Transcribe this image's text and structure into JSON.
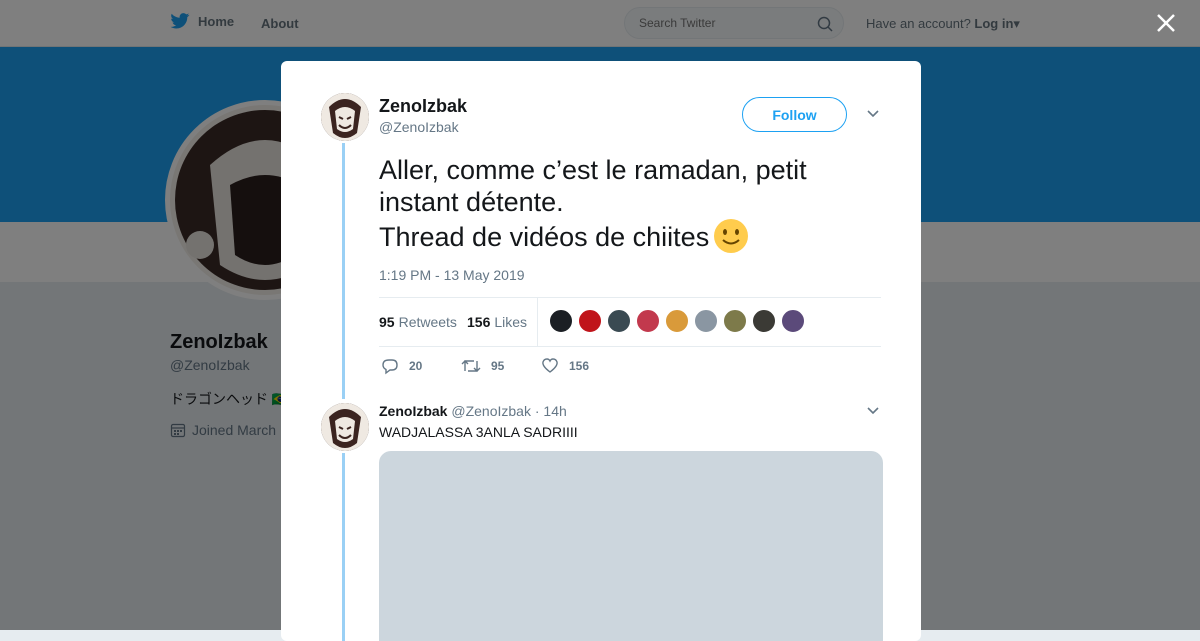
{
  "nav": {
    "home_label": "Home",
    "about_label": "About",
    "search_placeholder": "Search Twitter",
    "account_prompt": "Have an account?",
    "login_label": "Log in"
  },
  "colors": {
    "brand": "#1da1f2",
    "banner": "#1da1f2",
    "thread_line": "#9ad0f5"
  },
  "profile": {
    "name": "ZenoIzbak",
    "handle": "@ZenoIzbak",
    "bio": "ドラゴンヘッド 🇧🇷",
    "joined": "Joined March"
  },
  "tweet": {
    "author_name": "ZenoIzbak",
    "author_handle": "@ZenoIzbak",
    "follow_label": "Follow",
    "text_line1": "Aller, comme c’est le ramadan, petit",
    "text_line2": "instant détente.",
    "text_line3": "Thread de vidéos de chiites",
    "emoji": "slightly-smiling-face-emoji",
    "timestamp": "1:19 PM - 13 May 2019",
    "retweets_count": "95",
    "retweets_label": "Retweets",
    "likes_count": "156",
    "likes_label": "Likes",
    "liker_colors": [
      "#1b1f24",
      "#c0141a",
      "#3a4a52",
      "#c2394d",
      "#d99a3a",
      "#8a96a2",
      "#7d7a4a",
      "#3b3a35",
      "#5b4a7a"
    ],
    "actions": {
      "replies": "20",
      "retweets": "95",
      "likes": "156"
    }
  },
  "reply": {
    "author_name": "ZenoIzbak",
    "author_handle": "@ZenoIzbak",
    "separator": "·",
    "time": "14h",
    "text": "WADJALASSA 3ANLA SADRIIII"
  }
}
